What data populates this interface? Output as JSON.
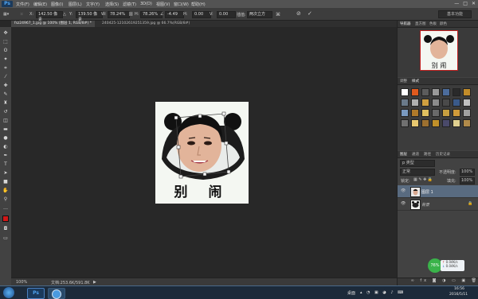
{
  "app": {
    "logo": "Ps",
    "menu": [
      "文件(F)",
      "编辑(E)",
      "图像(I)",
      "图层(L)",
      "文字(Y)",
      "选择(S)",
      "滤镜(T)",
      "3D(D)",
      "视图(V)",
      "窗口(W)",
      "帮助(H)"
    ]
  },
  "window_controls": [
    "—",
    "□",
    "✕"
  ],
  "options": {
    "x_label": "X:",
    "x_value": "142.50 像素",
    "y_label": "Y:",
    "y_value": "139.50 像素",
    "w_label": "W:",
    "w_value": "78.24%",
    "h_label": "H:",
    "h_value": "78.26%",
    "angle_value": "-4.49",
    "hskew_label": "H:",
    "hskew_value": "0.00",
    "vskew_label": "V:",
    "vskew_value": "0.00",
    "interp_label": "插值:",
    "interp_value": "两次立方",
    "workspace": "基本功能"
  },
  "tabs": [
    {
      "label": "fsz24967_1.jpg @ 100% (图层 1, RGB/8#) *",
      "active": true
    },
    {
      "label": "240425-12102619251359.jpg @ 66.7%(RGB/8#)",
      "active": false
    }
  ],
  "document": {
    "caption": "别 闹"
  },
  "status": {
    "zoom": "100%",
    "doc_info": "文档:253.6K/591.8K"
  },
  "panels": {
    "navigator_tabs": [
      "导航器",
      "直方图",
      "色板",
      "颜色"
    ],
    "styles_tabs": [
      "调整",
      "样式"
    ],
    "layers_tabs": [
      "图层",
      "通道",
      "路径",
      "历史记录"
    ],
    "kind_label": "p 类型",
    "blend_mode": "正常",
    "opacity_label": "不透明度:",
    "opacity_value": "100%",
    "lock_label": "锁定:",
    "fill_label": "填充:",
    "fill_value": "100%",
    "layers": [
      {
        "name": "图层 1",
        "selected": true
      },
      {
        "name": "背景",
        "selected": false
      }
    ],
    "style_colors": [
      "#ffffff",
      "#e05a1e",
      "#5c5c5c",
      "#9a9a9a",
      "#4c6c9c",
      "#2a2a2a",
      "#c28c2a",
      "#6a7a8a",
      "#b0b0b0",
      "#d0a040",
      "#8c8c8c",
      "#4a4a4a",
      "#3a5a8a",
      "#c0c0c0",
      "#7a9ac0",
      "#b07a2a",
      "#e0c060",
      "#6a6a6a",
      "#c8a040",
      "#d09a3a",
      "#a0a0a0",
      "#707070",
      "#e8c870",
      "#9c7030",
      "#c0902a",
      "#4a4a6a",
      "#e0d090",
      "#b08a4a"
    ]
  },
  "taskbar": {
    "desktop_label": "桌面",
    "time": "16:56",
    "date": "2016/5/11"
  },
  "net_widget": {
    "percent": "76%",
    "up": "0.04K/s",
    "down": "0.04K/s"
  }
}
